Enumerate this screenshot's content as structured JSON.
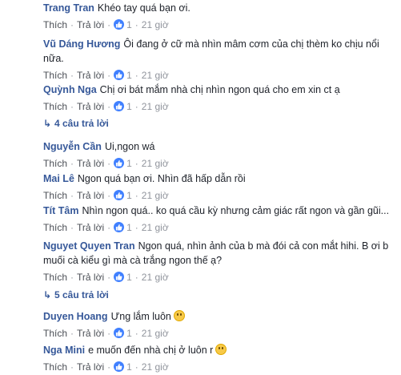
{
  "actions": {
    "like": "Thích",
    "reply": "Trả lời"
  },
  "comments": [
    {
      "name": "Trang Tran",
      "text": "Khéo tay quá bạn ơi.",
      "likes": "1",
      "time": "21 giờ"
    },
    {
      "name": "Vũ Dáng Hương",
      "text": "Ôi đang ở cữ mà nhìn mâm cơm của chị thèm ko chịu nổi",
      "text2": "nữa.",
      "likes": "1",
      "time": "21 giờ"
    },
    {
      "name": "Quỳnh Nga",
      "text": "Chị ơi bát mắm nhà chị nhìn ngon quá cho em xin ct ạ",
      "likes": "1",
      "time": "21 giờ"
    },
    {
      "name": "Nguyễn Cần",
      "text": "Ui,ngon wá",
      "likes": "1",
      "time": "21 giờ"
    },
    {
      "name": "Mai Lê",
      "text": "Ngon quá bạn ơi. Nhìn đã hấp dẫn rồi",
      "likes": "1",
      "time": "21 giờ"
    },
    {
      "name": "Tít Tâm",
      "text": "Nhìn ngon quá.. ko quá cầu kỳ nhưng cảm giác rất ngon và gần gũi...",
      "likes": "1",
      "time": "21 giờ"
    },
    {
      "name": "Nguyet Quyen Tran",
      "text": "Ngon quá, nhìn ảnh của b mà đói cả con mắt hihi. B ơi b",
      "text2": "muối cà kiểu gì mà cà trắng ngon thế ạ?",
      "likes": "1",
      "time": "21 giờ"
    },
    {
      "name": "Duyen Hoang",
      "text": "Ưng lắm luôn",
      "emoji": "smiley-emoji",
      "likes": "1",
      "time": "21 giờ"
    },
    {
      "name": "Nga Mini",
      "text": "e muốn đến nhà chị ở luôn r",
      "emoji": "smiley-emoji",
      "likes": "1",
      "time": "21 giờ"
    }
  ],
  "replies": [
    {
      "label": "4 câu trả lời"
    },
    {
      "label": "5 câu trả lời"
    }
  ],
  "colors": {
    "name": "#365899",
    "meta": "#90949c",
    "like_icon": "#4080ff"
  }
}
